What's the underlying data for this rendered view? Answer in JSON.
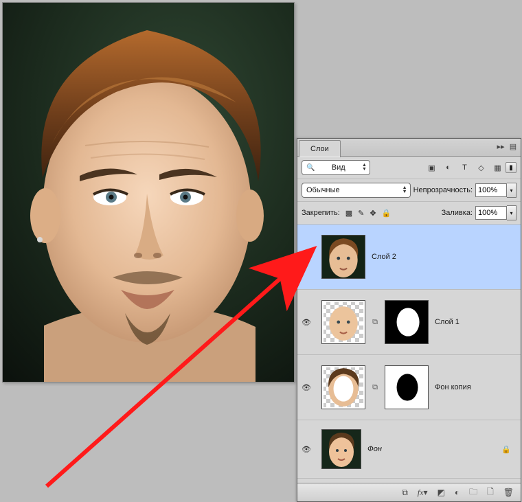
{
  "panel": {
    "tab_label": "Слои",
    "search": {
      "prefix_glyph": "🔍",
      "label": "Вид"
    },
    "blend_mode": "Обычные",
    "opacity_label": "Непрозрачность:",
    "opacity_value": "100%",
    "lock_label": "Закрепить:",
    "fill_label": "Заливка:",
    "fill_value": "100%"
  },
  "layers": [
    {
      "name": "Слой 2",
      "visible": true,
      "selected": true,
      "mask": null,
      "italic": false,
      "locked": false,
      "thumb": "composite"
    },
    {
      "name": "Слой 1",
      "visible": true,
      "selected": false,
      "mask": "white-on-black",
      "italic": false,
      "locked": false,
      "thumb": "face-cutout"
    },
    {
      "name": "Фон копия",
      "visible": true,
      "selected": false,
      "mask": "black-on-white",
      "italic": false,
      "locked": false,
      "thumb": "face-hole"
    },
    {
      "name": "Фон",
      "visible": true,
      "selected": false,
      "mask": null,
      "italic": true,
      "locked": true,
      "thumb": "base"
    }
  ],
  "footer_icons": [
    "link-icon",
    "fx-icon",
    "mask-icon",
    "adjustment-icon",
    "group-icon",
    "new-layer-icon",
    "trash-icon"
  ]
}
